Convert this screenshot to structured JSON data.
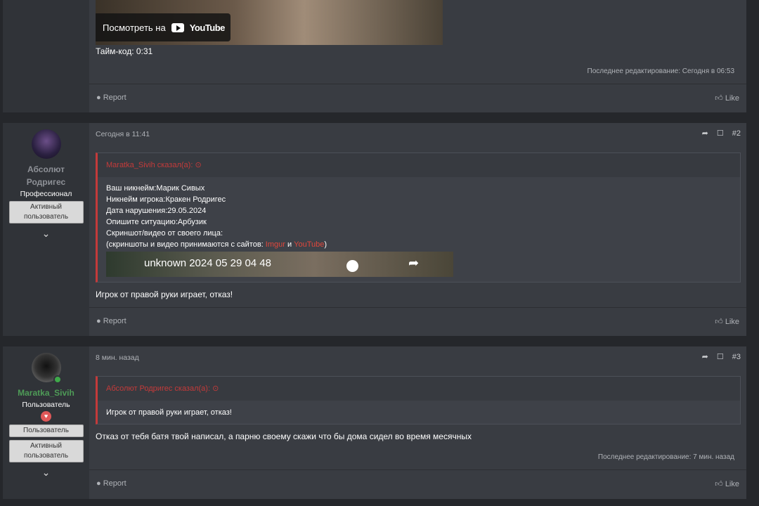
{
  "post1": {
    "youtube_watch": "Посмотреть на",
    "youtube_logo": "YouTube",
    "timecode": "Тайм-код: 0:31",
    "edit_note": "Последнее редактирование: Сегодня в 06:53",
    "report": "Report",
    "like": "Like"
  },
  "post2": {
    "user": {
      "name_line1": "Абсолют",
      "name_line2": "Родригес",
      "title": "Профессионал",
      "banner1_line1": "Активный",
      "banner1_line2": "пользователь"
    },
    "date": "Сегодня в 11:41",
    "number": "#2",
    "quote_author": "Maratka_Sivih сказал(а):",
    "quote_lines": [
      "Ваш никнейм:Марик Сивых",
      "Никнейм игрока:Кракен Родригес",
      "Дата нарушения:29.05.2024",
      "Опишите ситуацию:Арбузик",
      "Скриншот/видео от своего лица:"
    ],
    "quote_sites_prefix": "(скриншоты и видео принимаются с сайтов: ",
    "quote_link1": "Imgur",
    "quote_and": " и ",
    "quote_link2": "YouTube",
    "quote_sites_suffix": ")",
    "video_title": "unknown 2024 05 29 04 48",
    "text": "Игрок от правой руки играет, отказ!",
    "report": "Report",
    "like": "Like"
  },
  "post3": {
    "user": {
      "name": "Maratka_Sivih",
      "title": "Пользователь",
      "banner1": "Пользователь",
      "banner2_line1": "Активный",
      "banner2_line2": "пользователь"
    },
    "date": "8 мин. назад",
    "number": "#3",
    "quote_author": "Абсолют Родригес сказал(а):",
    "quote_text": "Игрок от правой руки играет, отказ!",
    "text": "Отказ от тебя батя твой написал, а парню своему скажи что бы дома сидел во время месячных",
    "edit_note": "Последнее редактирование: 7 мин. назад",
    "report": "Report",
    "like": "Like"
  }
}
